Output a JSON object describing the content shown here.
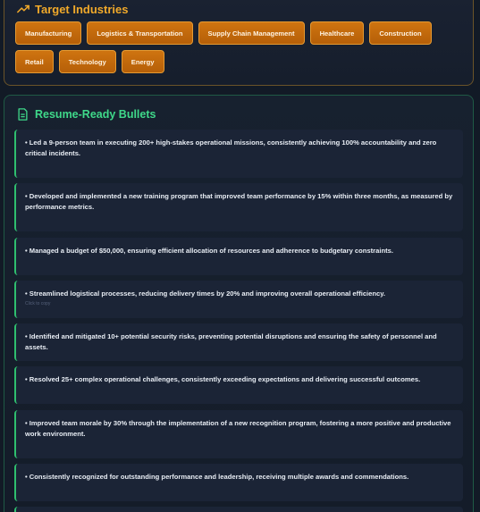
{
  "industries": {
    "title": "Target Industries",
    "icon": "trending-up-icon",
    "row1": [
      "Manufacturing",
      "Logistics & Transportation",
      "Supply Chain Management",
      "Healthcare",
      "Construction"
    ],
    "row2": [
      "Retail",
      "Technology",
      "Energy"
    ]
  },
  "bullets_section": {
    "title": "Resume-Ready Bullets",
    "icon": "document-icon",
    "items": [
      "• Led a 9-person team in executing 200+ high-stakes operational missions, consistently achieving 100% accountability and zero critical incidents.",
      "• Developed and implemented a new training program that improved team performance by 15% within three months, as measured by performance metrics.",
      "• Managed a budget of $50,000, ensuring efficient allocation of resources and adherence to budgetary constraints.",
      "• Streamlined logistical processes, reducing delivery times by 20% and improving overall operational efficiency.",
      "• Identified and mitigated 10+ potential security risks, preventing potential disruptions and ensuring the safety of personnel and assets.",
      "• Resolved 25+ complex operational challenges, consistently exceeding expectations and delivering successful outcomes.",
      "• Improved team morale by 30% through the implementation of a new recognition program, fostering a more positive and productive work environment.",
      "• Consistently recognized for outstanding performance and leadership, receiving multiple awards and commendations."
    ],
    "copy_hint": "Click to copy"
  },
  "colors": {
    "accent_orange": "#cf7410",
    "accent_green": "#3fd98a",
    "background": "#121a26"
  }
}
